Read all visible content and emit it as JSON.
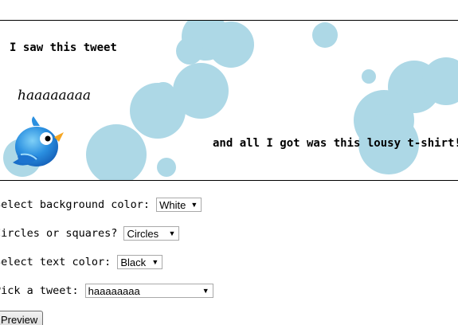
{
  "banner": {
    "line1": "I saw this tweet",
    "tweet": "haaaaaaaa",
    "line2": "and all I got was this lousy t-shirt!",
    "bubble_color": "#add8e6"
  },
  "form": {
    "background": {
      "label": "Select background color:",
      "value": "White"
    },
    "shape": {
      "label": "Circles or squares?",
      "value": "Circles"
    },
    "text_color": {
      "label": "Select text color:",
      "value": "Black"
    },
    "tweet": {
      "label": "Pick a tweet:",
      "value": "haaaaaaaa"
    },
    "preview_label": "Preview"
  }
}
